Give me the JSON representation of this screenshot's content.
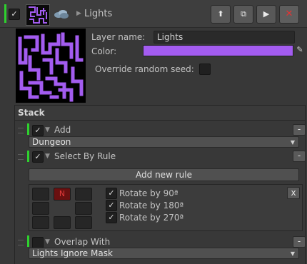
{
  "header": {
    "title": "Lights",
    "enabled": true,
    "buttons": {
      "up": "⬆",
      "duplicate": "⧉",
      "play": "▶",
      "remove": "✕"
    }
  },
  "layer": {
    "name_label": "Layer name:",
    "name_value": "Lights",
    "color_label": "Color:",
    "color_value": "#a35cf0",
    "seed_label": "Override random seed:",
    "seed_checked": false
  },
  "stack": {
    "title": "Stack",
    "items": [
      {
        "label": "Add",
        "enabled": true,
        "dropdown": "Dungeon"
      },
      {
        "label": "Select By Rule",
        "enabled": true,
        "add_rule_button": "Add new rule",
        "grid_center": "N",
        "remove_rule": "x",
        "rotations": [
          {
            "label": "Rotate by 90ª",
            "checked": true
          },
          {
            "label": "Rotate by 180ª",
            "checked": true
          },
          {
            "label": "Rotate by 270ª",
            "checked": true
          }
        ]
      },
      {
        "label": "Overlap With",
        "enabled": false,
        "dropdown": "Lights Ignore Mask"
      }
    ],
    "minus_label": "-"
  },
  "colors": {
    "accent_green": "#2ed12e",
    "layer_purple": "#a35cf0"
  }
}
